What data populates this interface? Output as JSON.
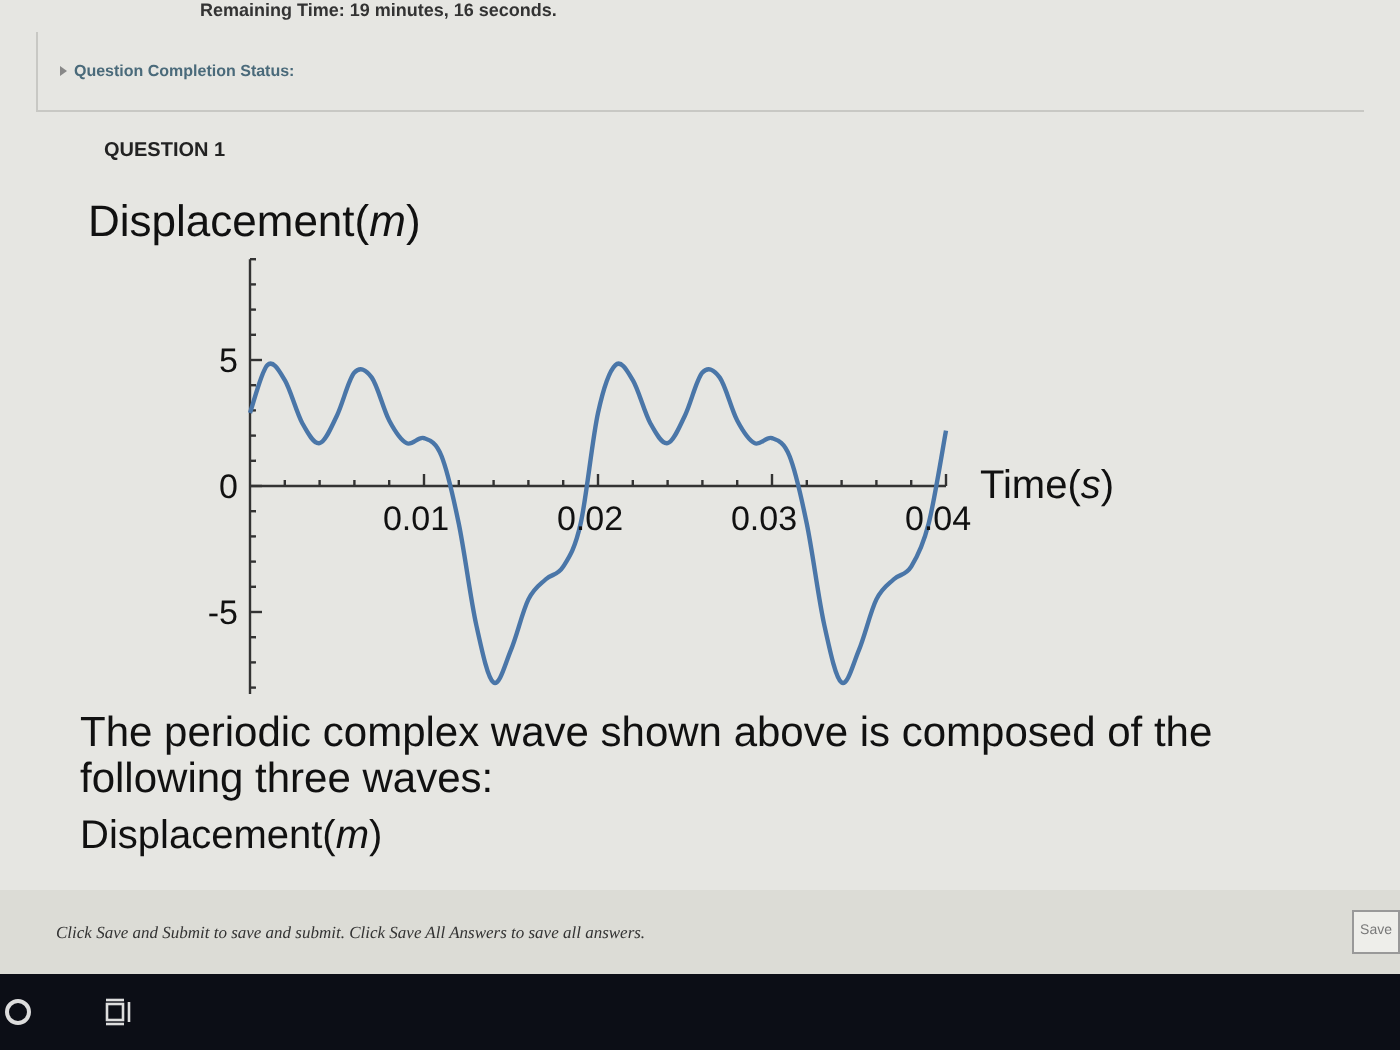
{
  "timer": "Remaining Time: 19 minutes, 16 seconds.",
  "completion_status": {
    "label": "Question Completion Status:",
    "expanded": false
  },
  "question": {
    "number": "QUESTION 1",
    "title": "Displacement(*m*)",
    "chart_data": {
      "type": "line",
      "xlabel": "Time(*s*)",
      "xlim": [
        0,
        0.04
      ],
      "ylim": [
        -8.5,
        9
      ],
      "xticks": [
        0.01,
        0.02,
        0.03,
        0.04
      ],
      "yticks": [
        -5,
        0,
        5
      ],
      "x": [
        0,
        0.001,
        0.002,
        0.003,
        0.004,
        0.005,
        0.006,
        0.007,
        0.008,
        0.009,
        0.01,
        0.011,
        0.012,
        0.013,
        0.014,
        0.015,
        0.016,
        0.017,
        0.018,
        0.019,
        0.02,
        0.021,
        0.022,
        0.023,
        0.024,
        0.025,
        0.026,
        0.027,
        0.028,
        0.029,
        0.03,
        0.031,
        0.032,
        0.033,
        0.034,
        0.035,
        0.036,
        0.037,
        0.038,
        0.039,
        0.04
      ],
      "series": [
        {
          "color": "#4a76a8",
          "values": [
            2.9,
            4.8,
            4.2,
            2.5,
            1.7,
            2.8,
            4.5,
            4.3,
            2.6,
            1.7,
            1.9,
            1.2,
            -1.5,
            -5.5,
            -7.8,
            -6.5,
            -4.5,
            -3.7,
            -3.2,
            -1.5,
            2.9,
            4.8,
            4.2,
            2.5,
            1.7,
            2.8,
            4.5,
            4.3,
            2.6,
            1.7,
            1.9,
            1.2,
            -1.5,
            -5.5,
            -7.8,
            -6.5,
            -4.5,
            -3.7,
            -3.2,
            -1.5,
            2.2
          ]
        }
      ]
    },
    "text": "The periodic complex wave shown above is composed of the following three waves:",
    "subtitle": "Displacement(*m*)"
  },
  "footer": {
    "instruction": "Click Save and Submit to save and submit. Click Save All Answers to save all answers.",
    "button": "Save"
  }
}
